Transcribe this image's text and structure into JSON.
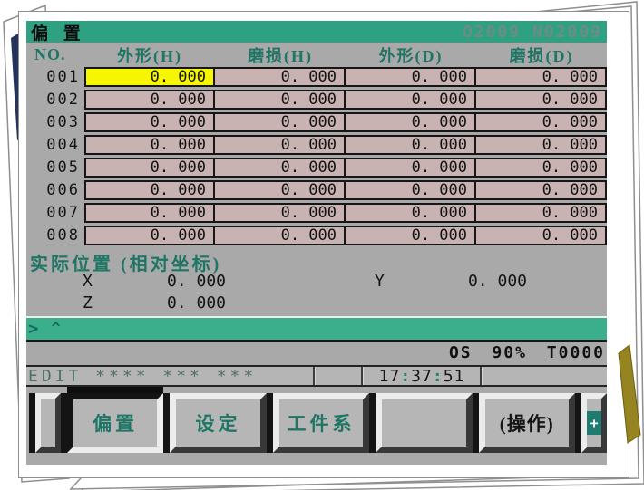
{
  "titlebar": {
    "title": "偏 置",
    "program": "O2009 N02009"
  },
  "table": {
    "headers": [
      "NO.",
      "外形(H)",
      "磨损(H)",
      "外形(D)",
      "磨损(D)"
    ],
    "rows": [
      {
        "no": "001",
        "values": [
          "0. 000",
          "0. 000",
          "0. 000",
          "0. 000"
        ]
      },
      {
        "no": "002",
        "values": [
          "0. 000",
          "0. 000",
          "0. 000",
          "0. 000"
        ]
      },
      {
        "no": "003",
        "values": [
          "0. 000",
          "0. 000",
          "0. 000",
          "0. 000"
        ]
      },
      {
        "no": "004",
        "values": [
          "0. 000",
          "0. 000",
          "0. 000",
          "0. 000"
        ]
      },
      {
        "no": "005",
        "values": [
          "0. 000",
          "0. 000",
          "0. 000",
          "0. 000"
        ]
      },
      {
        "no": "006",
        "values": [
          "0. 000",
          "0. 000",
          "0. 000",
          "0. 000"
        ]
      },
      {
        "no": "007",
        "values": [
          "0. 000",
          "0. 000",
          "0. 000",
          "0. 000"
        ]
      },
      {
        "no": "008",
        "values": [
          "0. 000",
          "0. 000",
          "0. 000",
          "0. 000"
        ]
      }
    ]
  },
  "actual_position": {
    "label": "实际位置 (相对坐标)",
    "x_name": "X",
    "x_value": "0. 000",
    "y_name": "Y",
    "y_value": "0. 000",
    "z_name": "Z",
    "z_value": "0. 000"
  },
  "input_line": {
    "prompt": ">",
    "cursor": "^"
  },
  "os_line": "OS 90% T0000",
  "status_bar": {
    "mode": "EDIT **** *** ***",
    "time_h": "17",
    "time_m": "37",
    "time_s": "51",
    "colon": ":"
  },
  "softkeys": {
    "keys": [
      {
        "label": "偏置"
      },
      {
        "label": "设定"
      },
      {
        "label": "工件系"
      },
      {
        "label": ""
      },
      {
        "label": "(操作)"
      }
    ],
    "more": "+"
  },
  "colors": {
    "titlebar_green": "#2fa183",
    "input_green": "#3bae8c",
    "cell_pink": "#c9b2b2",
    "cursor_yellow": "#f6f600",
    "teal_text": "#1f7565",
    "plus_key_teal": "#1f7a70"
  }
}
